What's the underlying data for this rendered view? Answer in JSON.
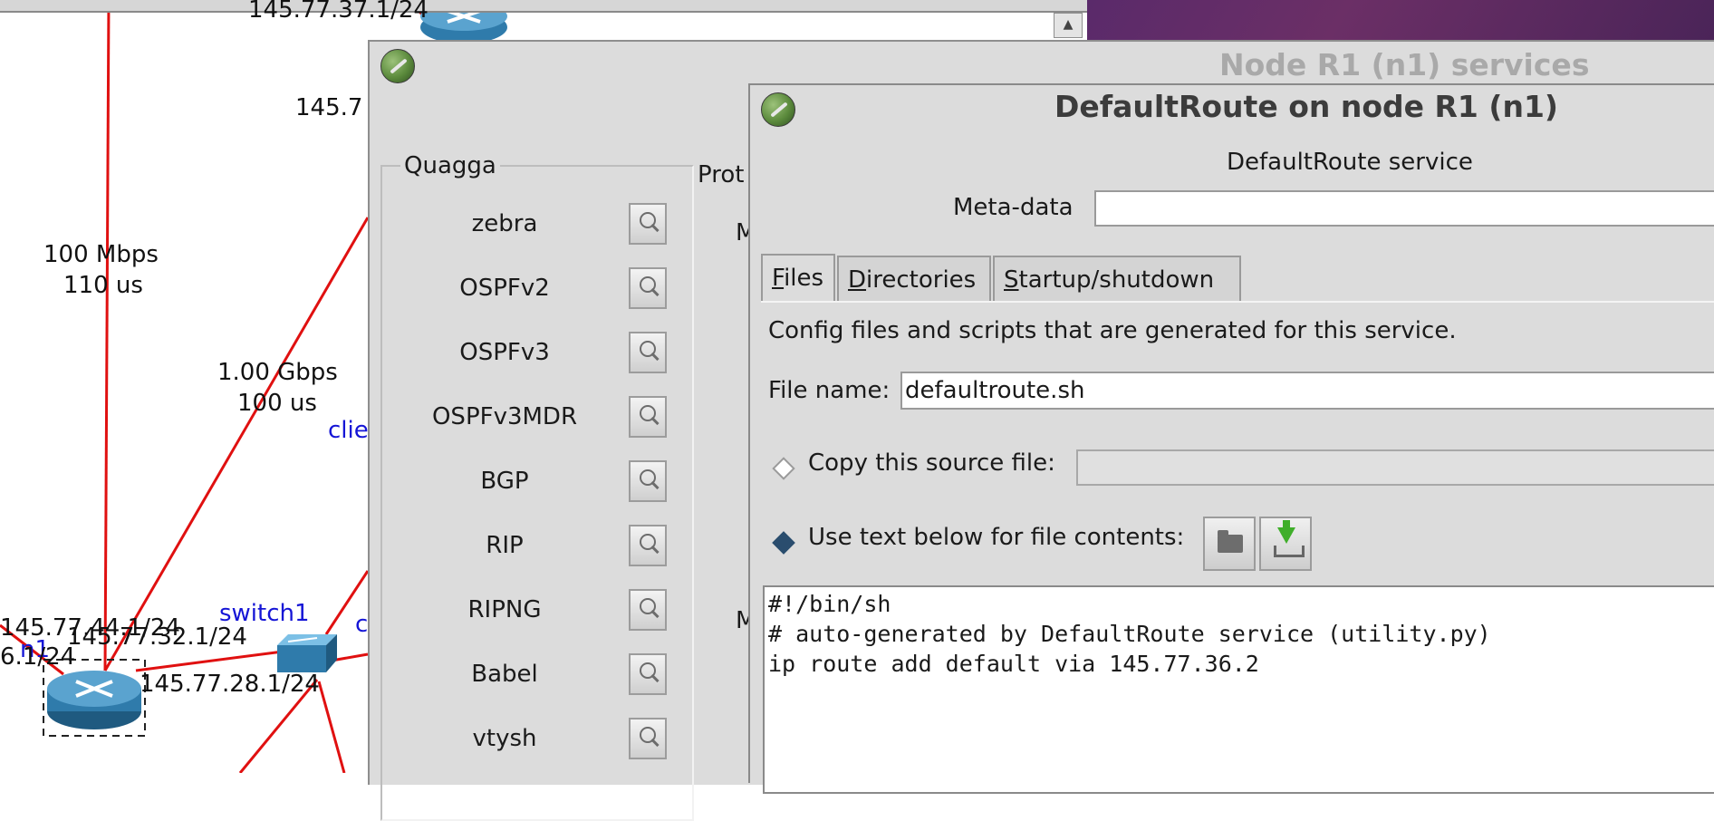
{
  "topology": {
    "link_labels": {
      "ip_top_partial": "145.77.37.1/24",
      "ip_left_partial": "145.7",
      "ip_44": "145.77.44.1/24",
      "ip_32": "145.77.32.1/24",
      "ip_28": "145.77.28.1/24",
      "ip_36_partial": "6.1/24",
      "link1_bw": "100 Mbps",
      "link1_delay": "110 us",
      "link2_bw": "1.00 Gbps",
      "link2_delay": "100 us"
    },
    "node_labels": {
      "switch": "switch1",
      "client_partial": "clie",
      "client_partial2": "c",
      "router_partial": "n1"
    },
    "link_color": "#e01010"
  },
  "services_window": {
    "title": "Node R1 (n1) services",
    "group_title": "Quagga",
    "proto_partial": "Prot",
    "m1": "M",
    "m2": "M",
    "services": [
      "zebra",
      "OSPFv2",
      "OSPFv3",
      "OSPFv3MDR",
      "BGP",
      "RIP",
      "RIPNG",
      "Babel",
      "vtysh"
    ]
  },
  "defaultroute_window": {
    "title": "DefaultRoute on node R1 (n1)",
    "subtitle": "DefaultRoute service",
    "meta_label": "Meta-data",
    "meta_value": "",
    "tabs": [
      {
        "label": "Files",
        "underline": "F",
        "rest": "iles"
      },
      {
        "label": "Directories",
        "underline": "D",
        "rest": "irectories"
      },
      {
        "label": "Startup/shutdown",
        "underline": "S",
        "rest": "tartup/shutdown"
      }
    ],
    "description": "Config files and scripts that are generated for this service.",
    "file_name_label": "File name:",
    "file_name_value": "defaultroute.sh",
    "copy_source_label": "Copy this source file:",
    "use_text_label": "Use text below for file contents:",
    "copy_source_selected": false,
    "use_text_selected": true,
    "file_contents": "#!/bin/sh\n# auto-generated by DefaultRoute service (utility.py)\nip route add default via 145.77.36.2",
    "icons": [
      "folder-open-icon",
      "download-icon"
    ]
  }
}
